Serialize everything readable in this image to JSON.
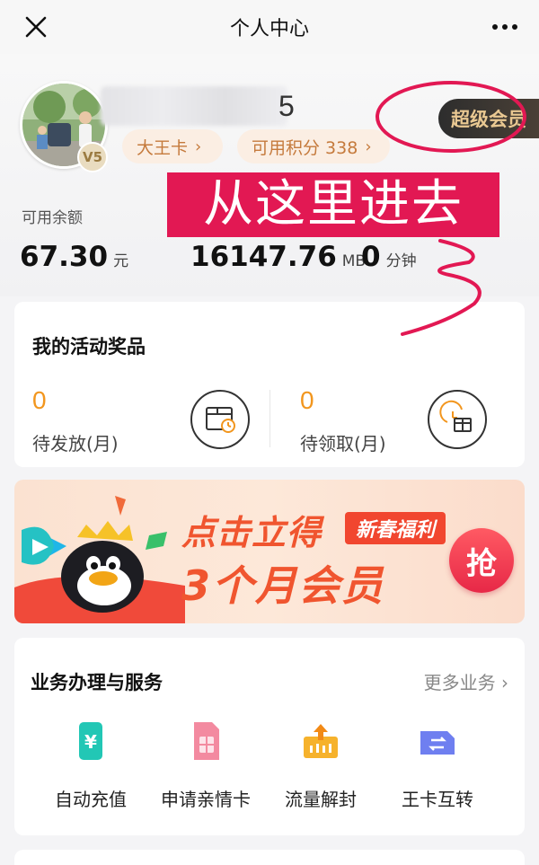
{
  "nav": {
    "title": "个人中心"
  },
  "profile": {
    "level": "V5",
    "username_visible": "5",
    "card_label": "大王卡",
    "points_label": "可用积分 338",
    "super_vip_label": "超级会员"
  },
  "stats": {
    "balance_label": "可用余额",
    "balance_value": "67.30",
    "balance_unit": "元",
    "data_value": "16147.76",
    "data_unit": "MB",
    "minutes_value": "0",
    "minutes_unit": "分钟"
  },
  "annotation": {
    "text": "从这里进去",
    "color": "#e21853"
  },
  "activity": {
    "title": "我的活动奖品",
    "items": [
      {
        "count": "0",
        "label": "待发放(月)"
      },
      {
        "count": "0",
        "label": "待领取(月)"
      }
    ]
  },
  "banner": {
    "line1": "点击立得",
    "tag": "新春福利",
    "line2": "3个月会员",
    "button": "抢"
  },
  "services": {
    "title": "业务办理与服务",
    "more": "更多业务",
    "items": [
      {
        "label": "自动充值",
        "icon": "yen-recharge-icon"
      },
      {
        "label": "申请亲情卡",
        "icon": "sim-card-icon"
      },
      {
        "label": "流量解封",
        "icon": "data-unlock-icon"
      },
      {
        "label": "王卡互转",
        "icon": "card-transfer-icon"
      }
    ]
  },
  "colors": {
    "accent": "#f2961e",
    "brand_red": "#f0552f",
    "pill_text": "#c57a3c"
  }
}
